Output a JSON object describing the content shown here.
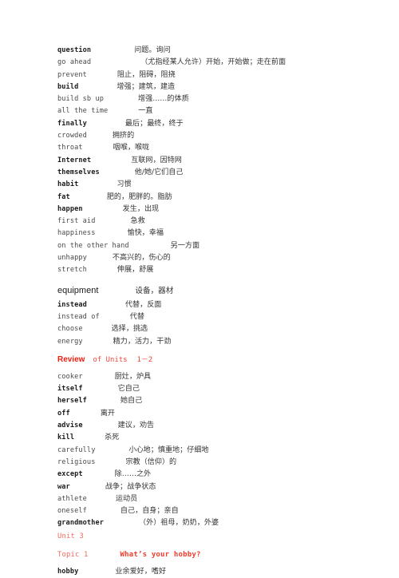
{
  "document": {
    "type": "vocabulary-glossary",
    "background_color": "#ffffff",
    "text_color": "#333333",
    "accent_color": "#f01e10"
  },
  "entries": [
    {
      "term": "question",
      "bold": true,
      "gap": 54,
      "gloss": "问题。询问"
    },
    {
      "term": "go ahead",
      "bold": false,
      "gap": 62,
      "gloss": "（尤指经某人允许）开始，开始做；走在前面"
    },
    {
      "term": "prevent",
      "bold": false,
      "gap": 38,
      "gloss": "阻止，阻碍，阻挠"
    },
    {
      "term": "build",
      "bold": true,
      "gap": 48,
      "gloss": "增强；建筑，建造"
    },
    {
      "term": "build sb up",
      "bold": false,
      "gap": 43,
      "gloss": "增强……的体质"
    },
    {
      "term": "all the time",
      "bold": false,
      "gap": 38,
      "gloss": "一直"
    },
    {
      "term": "finally",
      "bold": true,
      "gap": 48,
      "gloss": "最后；最终，终于"
    },
    {
      "term": "crowded",
      "bold": false,
      "gap": 32,
      "gloss": "拥挤的"
    },
    {
      "term": "throat",
      "bold": false,
      "gap": 38,
      "gloss": "咽喉，喉咙"
    },
    {
      "term": "Internet",
      "bold": true,
      "gap": 50,
      "gloss": "互联网，因特网"
    },
    {
      "term": "themselves",
      "bold": true,
      "gap": 44,
      "gloss": "他/她/它们自己"
    },
    {
      "term": "habit",
      "bold": true,
      "gap": 48,
      "gloss": "习惯"
    },
    {
      "term": "fat",
      "bold": true,
      "gap": 46,
      "gloss": "肥的，肥胖的。脂肪"
    },
    {
      "term": "happen",
      "bold": true,
      "gap": 50,
      "gloss": "发生，出现"
    },
    {
      "term": "first aid",
      "bold": false,
      "gap": 44,
      "gloss": "急救"
    },
    {
      "term": "happiness",
      "bold": false,
      "gap": 40,
      "gloss": "愉快，幸福"
    },
    {
      "term": "on the other hand",
      "bold": false,
      "gap": 52,
      "gloss": "另一方面"
    },
    {
      "term": "unhappy",
      "bold": false,
      "gap": 32,
      "gloss": "不高兴的，伤心的"
    },
    {
      "term": "stretch",
      "bold": false,
      "gap": 38,
      "gloss": "伸展，舒展"
    }
  ],
  "equipment_entry": {
    "term": "equipment",
    "gap": 46,
    "gloss": "设备，器材"
  },
  "entries2": [
    {
      "term": "instead",
      "bold": true,
      "gap": 48,
      "gloss": "代替，反面"
    },
    {
      "term": "instead of",
      "bold": false,
      "gap": 38,
      "gloss": "代替"
    },
    {
      "term": "choose",
      "bold": false,
      "gap": 36,
      "gloss": "选择，挑选"
    },
    {
      "term": "energy",
      "bold": false,
      "gap": 38,
      "gloss": "精力，活力，干劲"
    }
  ],
  "review_heading": {
    "title": "Review",
    "subtitle": "of Units",
    "units": "1－2"
  },
  "entries3": [
    {
      "term": "cooker",
      "bold": false,
      "gap": 40,
      "gloss": "厨灶，炉具"
    },
    {
      "term": "itself",
      "bold": true,
      "gap": 44,
      "gloss": "它自己"
    },
    {
      "term": "herself",
      "bold": true,
      "gap": 42,
      "gloss": "她自己"
    },
    {
      "term": "off",
      "bold": true,
      "gap": 38,
      "gloss": "离开"
    },
    {
      "term": "advise",
      "bold": true,
      "gap": 44,
      "gloss": "建议，劝告"
    },
    {
      "term": "kill",
      "bold": true,
      "gap": 38,
      "gloss": "杀死"
    },
    {
      "term": "carefully",
      "bold": false,
      "gap": 42,
      "gloss": "小心地；慎重地；仔细地"
    },
    {
      "term": "religious",
      "bold": false,
      "gap": 38,
      "gloss": "宗教（信仰）的"
    },
    {
      "term": "except",
      "bold": true,
      "gap": 40,
      "gloss": "除……之外"
    },
    {
      "term": "war",
      "bold": true,
      "gap": 44,
      "gloss": "战争；战争状态"
    },
    {
      "term": "athlete",
      "bold": false,
      "gap": 36,
      "gloss": "运动员"
    },
    {
      "term": "oneself",
      "bold": false,
      "gap": 42,
      "gloss": "自己，自身；亲自"
    },
    {
      "term": "grandmother",
      "bold": true,
      "gap": 44,
      "gloss": "（外）祖母，奶奶，外婆"
    }
  ],
  "unit_heading": {
    "label": "Unit 3"
  },
  "topic_heading": {
    "label": "Topic 1",
    "gap": 40,
    "title": "What’s your hobby?"
  },
  "entries4": [
    {
      "term": "hobby",
      "bold": true,
      "gap": 46,
      "gloss": "业余爱好，嗜好"
    }
  ]
}
